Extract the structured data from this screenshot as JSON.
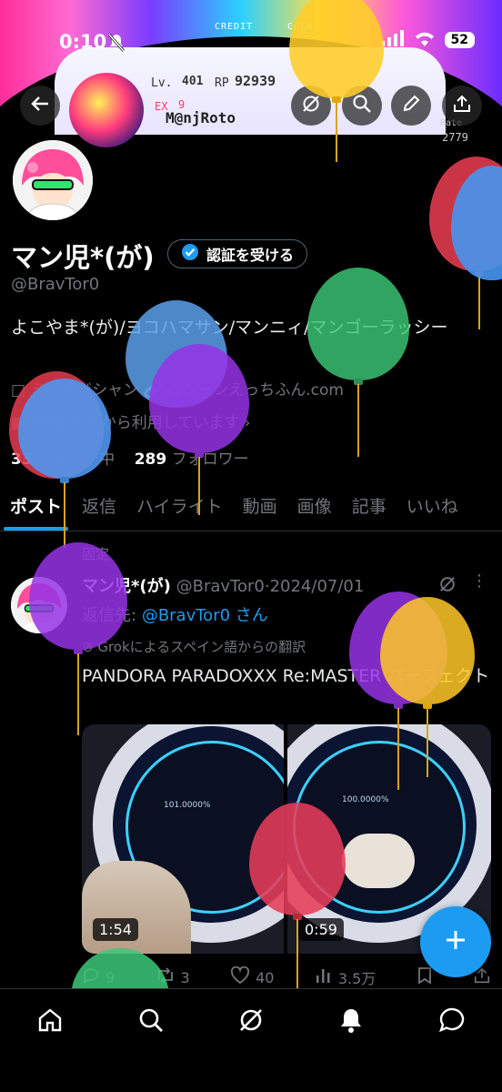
{
  "status_bar": {
    "time": "0:10",
    "battery": "52"
  },
  "banner": {
    "credit": "CREDIT",
    "coin": "COIN",
    "level_label": "Lv.",
    "level": "401",
    "rp_label": "RP",
    "rp": "92939",
    "player_name": "M@njRoto",
    "ex_label": "EX",
    "ex_value": "9",
    "rank_icon": "XIV",
    "rate_label": "Rate",
    "rate": "2779"
  },
  "header": {
    "back": "back-arrow",
    "icons": [
      "grok-icon",
      "search-icon",
      "edit-icon",
      "share-icon"
    ]
  },
  "profile": {
    "name": "マン児*(が)",
    "verify_button": "認証を受ける",
    "handle": "@BravTor0",
    "bio": "よこやま*(が)/ヨコハマサン/マンニィ/マンゴーラッシー",
    "category": "ミュージシャン",
    "link": "@ンーンえっちふん.com",
    "joined": "20年10月から利用しています",
    "following_count": "33",
    "following_label": "フォロー中",
    "followers_count": "289",
    "followers_label": "フォロワー"
  },
  "tabs": [
    "ポスト",
    "返信",
    "ハイライト",
    "動画",
    "画像",
    "記事",
    "いいね"
  ],
  "post": {
    "pinned_label": "固定",
    "author_name": "マン児*(が)",
    "author_handle": "@BravTor0",
    "date": "2024/07/01",
    "reply_prefix": "返信先:",
    "reply_to": "@BravTor0 さん",
    "translation_note": "Grokによるスペイン語からの翻訳",
    "text": "PANDORA PARADOXXX Re:MASTER パーフェクト",
    "media": [
      {
        "duration": "1:54",
        "score": "101.0000%"
      },
      {
        "duration": "0:59",
        "score": "100.0000%"
      }
    ],
    "replies": "9",
    "reposts": "3",
    "likes": "40",
    "views": "3.5万"
  },
  "nav": [
    "home-icon",
    "search-icon",
    "grok-icon",
    "notifications-icon",
    "messages-icon"
  ],
  "colors": {
    "accent": "#1d9bf0",
    "background": "#000000",
    "muted": "#71767b"
  }
}
